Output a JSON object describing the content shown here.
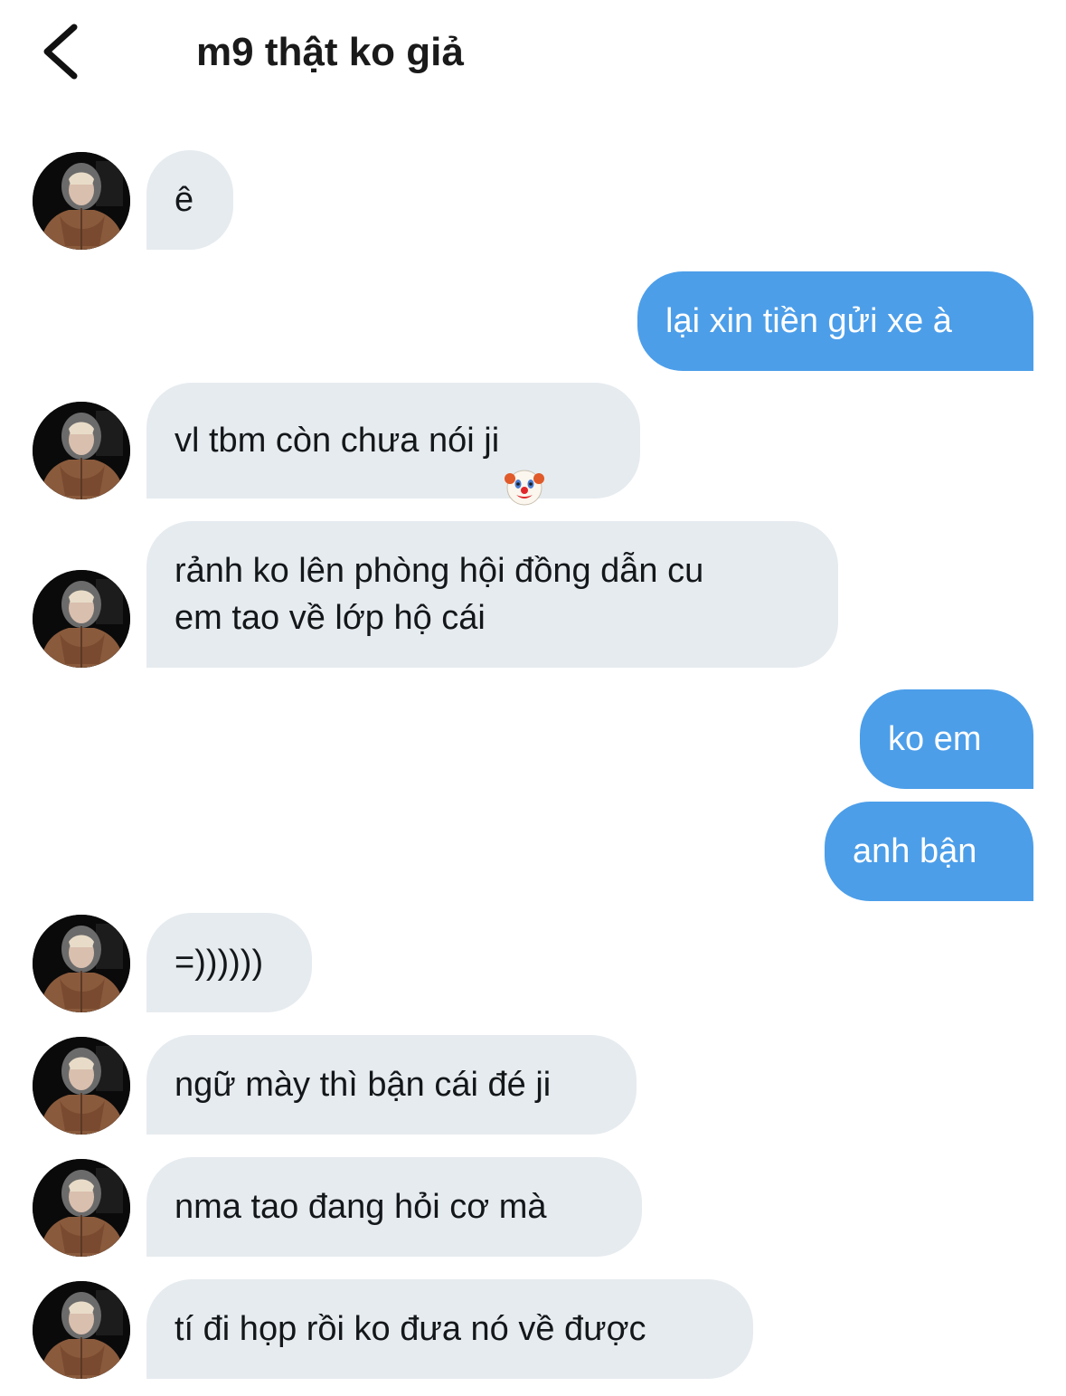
{
  "header": {
    "back_icon": "chevron-left-icon",
    "title": "m9 thật ko giả"
  },
  "messages": [
    {
      "from": "them",
      "text": "ê"
    },
    {
      "from": "me",
      "text": "lại xin tiền gửi xe à"
    },
    {
      "from": "them",
      "text": "vl tbm còn chưa nói ji",
      "emoji": "clown-face-icon"
    },
    {
      "from": "them",
      "text": "rảnh ko lên phòng hội đồng dẫn cu\nem tao về lớp hộ cái"
    },
    {
      "from": "me",
      "text": "ko em"
    },
    {
      "from": "me",
      "text": "anh bận"
    },
    {
      "from": "them",
      "text": "=))))))"
    },
    {
      "from": "them",
      "text": "ngữ mày thì bận cái đé ji"
    },
    {
      "from": "them",
      "text": "nma tao đang hỏi cơ mà"
    },
    {
      "from": "them",
      "text": "tí đi họp rồi ko đưa nó về được"
    }
  ],
  "colors": {
    "incoming_bubble": "#e6ebef",
    "outgoing_bubble": "#4c9ee9",
    "outgoing_text": "#ffffff",
    "incoming_text": "#14171a"
  }
}
